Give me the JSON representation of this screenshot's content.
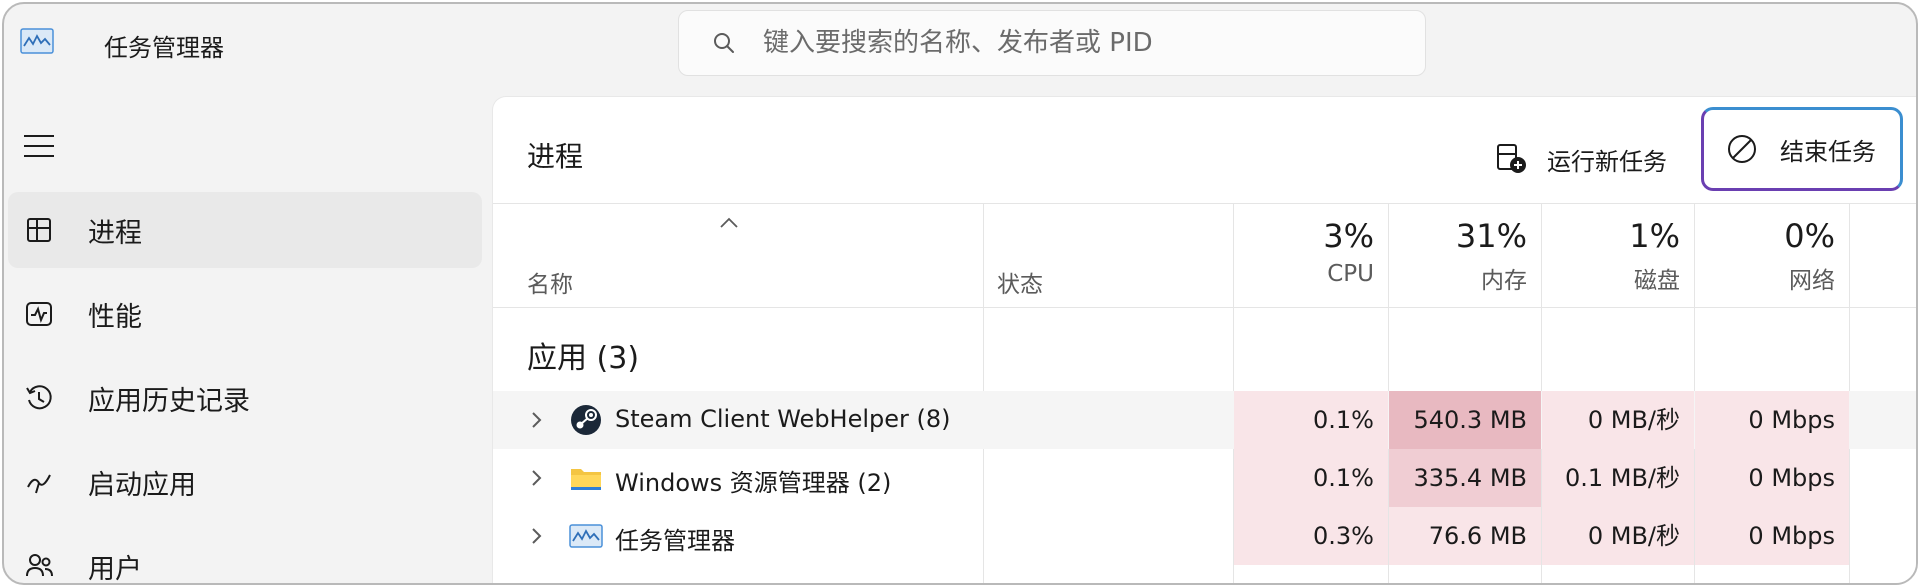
{
  "app": {
    "title": "任务管理器"
  },
  "search": {
    "placeholder": "键入要搜索的名称、发布者或 PID"
  },
  "sidebar": {
    "items": [
      {
        "label": "进程",
        "icon": "processes-icon",
        "active": true
      },
      {
        "label": "性能",
        "icon": "performance-icon",
        "active": false
      },
      {
        "label": "应用历史记录",
        "icon": "history-icon",
        "active": false
      },
      {
        "label": "启动应用",
        "icon": "startup-icon",
        "active": false
      },
      {
        "label": "用户",
        "icon": "users-icon",
        "active": false
      }
    ]
  },
  "main": {
    "title": "进程",
    "run_task_label": "运行新任务",
    "end_task_label": "结束任务"
  },
  "table": {
    "columns": {
      "name": "名称",
      "status": "状态",
      "cpu": {
        "pct": "3%",
        "label": "CPU"
      },
      "memory": {
        "pct": "31%",
        "label": "内存"
      },
      "disk": {
        "pct": "1%",
        "label": "磁盘"
      },
      "network": {
        "pct": "0%",
        "label": "网络"
      }
    },
    "group_title": "应用 (3)",
    "rows": [
      {
        "name": "Steam Client WebHelper (8)",
        "icon": "steam-icon",
        "cpu": "0.1%",
        "memory": "540.3 MB",
        "disk": "0 MB/秒",
        "network": "0 Mbps"
      },
      {
        "name": "Windows 资源管理器 (2)",
        "icon": "folder-icon",
        "cpu": "0.1%",
        "memory": "335.4 MB",
        "disk": "0.1 MB/秒",
        "network": "0 Mbps"
      },
      {
        "name": "任务管理器",
        "icon": "task-manager-icon",
        "cpu": "0.3%",
        "memory": "76.6 MB",
        "disk": "0 MB/秒",
        "network": "0 Mbps"
      }
    ]
  },
  "colors": {
    "heat_light": "#f9e5e8",
    "heat_medium": "#f0cdd3",
    "heat_strong": "#e8b9c1",
    "end_task_border_top": "#3b8ed0",
    "end_task_border_bottom": "#6a3fb1"
  }
}
